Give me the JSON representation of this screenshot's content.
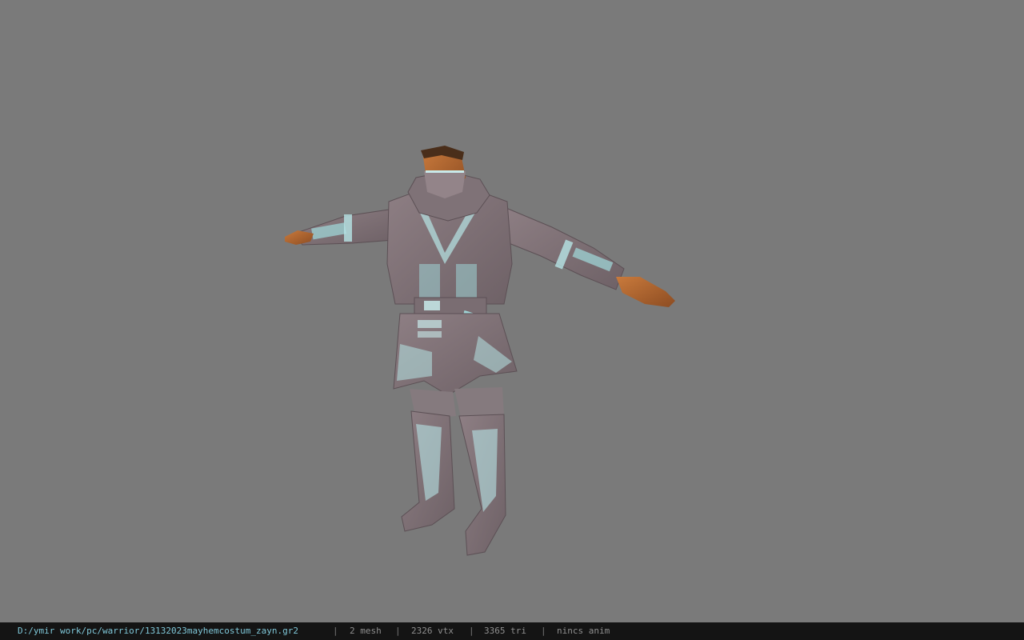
{
  "viewport": {
    "background_color": "#7a7a7a",
    "model_name": "mayhemcostum_zayn"
  },
  "statusbar": {
    "file_path": "D:/ymir work/pc/warrior/13132023mayhemcostum_zayn.gr2",
    "mesh_count": "2 mesh",
    "vertex_count": "2326 vtx",
    "triangle_count": "3365 tri",
    "animation": "nincs anim",
    "separator": "|",
    "path_color": "#7fc7d8",
    "background_color": "#141414"
  }
}
